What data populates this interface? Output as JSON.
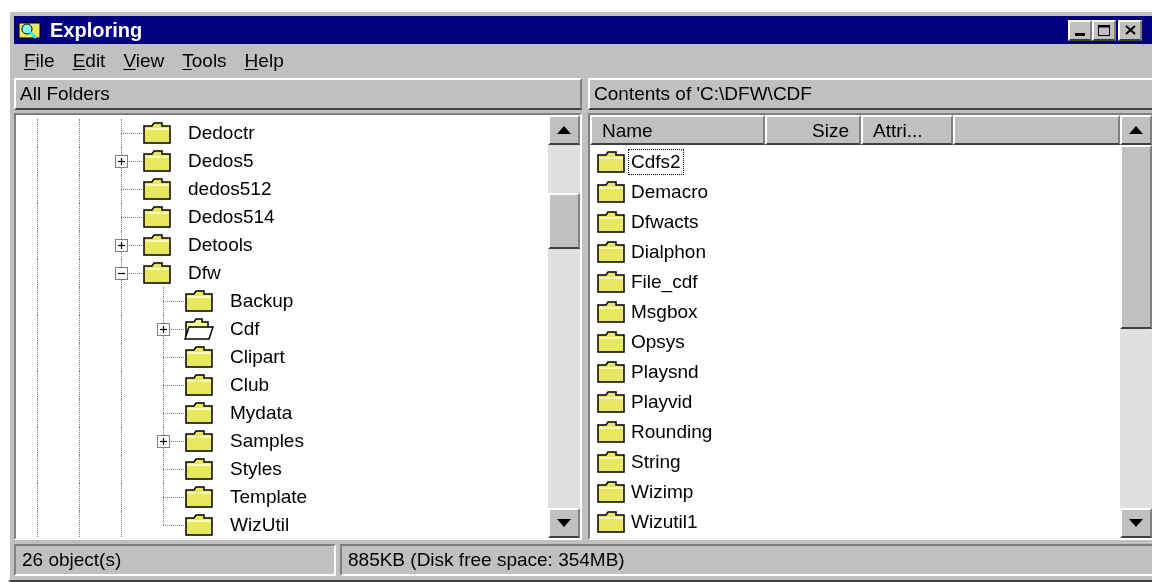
{
  "window": {
    "title": "Exploring"
  },
  "menu": [
    "File",
    "Edit",
    "View",
    "Tools",
    "Help"
  ],
  "tree": {
    "header": "All Folders",
    "items": [
      {
        "label": "Dedoctr",
        "selected": false
      },
      {
        "label": "Dedos5",
        "selected": false,
        "expanded": false
      },
      {
        "label": "dedos512",
        "selected": false
      },
      {
        "label": "Dedos514",
        "selected": false
      },
      {
        "label": "Detools",
        "selected": false,
        "expanded": false
      },
      {
        "label": "Dfw",
        "selected": false,
        "expanded": true,
        "children": [
          {
            "label": "Backup",
            "selected": false
          },
          {
            "label": "Cdf",
            "selected": true,
            "expanded": false
          },
          {
            "label": "Clipart",
            "selected": false
          },
          {
            "label": "Club",
            "selected": false
          },
          {
            "label": "Mydata",
            "selected": false
          },
          {
            "label": "Samples",
            "selected": false,
            "expanded": false
          },
          {
            "label": "Styles",
            "selected": false
          },
          {
            "label": "Template",
            "selected": false
          },
          {
            "label": "WizUtil",
            "selected": false
          }
        ]
      }
    ]
  },
  "contents": {
    "header": "Contents of 'C:\\DFW\\CDF",
    "columns": [
      "Name",
      "Size",
      "Attri..."
    ],
    "rows": [
      {
        "name": "Cdfs2",
        "selected": true
      },
      {
        "name": "Demacro",
        "selected": false
      },
      {
        "name": "Dfwacts",
        "selected": false
      },
      {
        "name": "Dialphon",
        "selected": false
      },
      {
        "name": "File_cdf",
        "selected": false
      },
      {
        "name": "Msgbox",
        "selected": false
      },
      {
        "name": "Opsys",
        "selected": false
      },
      {
        "name": "Playsnd",
        "selected": false
      },
      {
        "name": "Playvid",
        "selected": false
      },
      {
        "name": "Rounding",
        "selected": false
      },
      {
        "name": "String",
        "selected": false
      },
      {
        "name": "Wizimp",
        "selected": false
      },
      {
        "name": "Wizutil1",
        "selected": false
      }
    ]
  },
  "status_bar": [
    "26 object(s)",
    "885KB (Disk free space: 354MB)"
  ]
}
